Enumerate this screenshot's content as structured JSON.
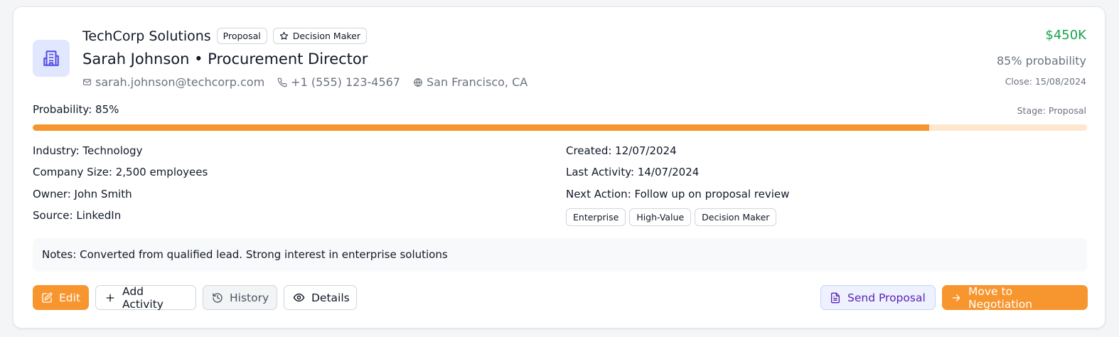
{
  "lead": {
    "company": "TechCorp Solutions",
    "stage_badge": "Proposal",
    "role_badge": "Decision Maker",
    "contact_line": "Sarah Johnson • Procurement Director",
    "email": "sarah.johnson@techcorp.com",
    "phone": "+1 (555) 123-4567",
    "location": "San Francisco, CA",
    "value": "$450K",
    "probability_text": "85% probability",
    "close_text": "Close: 15/08/2024"
  },
  "progress": {
    "label": "Probability: 85%",
    "stage_text": "Stage: Proposal",
    "fraction": 0.85
  },
  "details": {
    "industry": "Industry: Technology",
    "company_size": "Company Size: 2,500 employees",
    "owner": "Owner: John Smith",
    "source": "Source: LinkedIn",
    "created": "Created: 12/07/2024",
    "last_activity": "Last Activity: 14/07/2024",
    "next_action": "Next Action: Follow up on proposal review"
  },
  "tags": [
    "Enterprise",
    "High-Value",
    "Decision Maker"
  ],
  "notes": "Notes: Converted from qualified lead. Strong interest in enterprise solutions",
  "actions": {
    "edit": "Edit",
    "add_activity": "Add Activity",
    "history": "History",
    "details": "Details",
    "send_proposal": "Send Proposal",
    "move": "Move to Negotiation"
  },
  "colors": {
    "accent": "#f7962f",
    "value_green": "#16a34a",
    "purple": "#5b21b6",
    "avatar_bg": "#e0e7ff"
  },
  "icons": {
    "avatar": "building-icon",
    "role_badge": "star-icon",
    "email": "mail-icon",
    "phone": "phone-icon",
    "location": "globe-icon",
    "edit": "edit-icon",
    "add_activity": "plus-icon",
    "history": "history-icon",
    "details": "eye-icon",
    "send_proposal": "file-icon",
    "move": "arrow-right-icon"
  }
}
